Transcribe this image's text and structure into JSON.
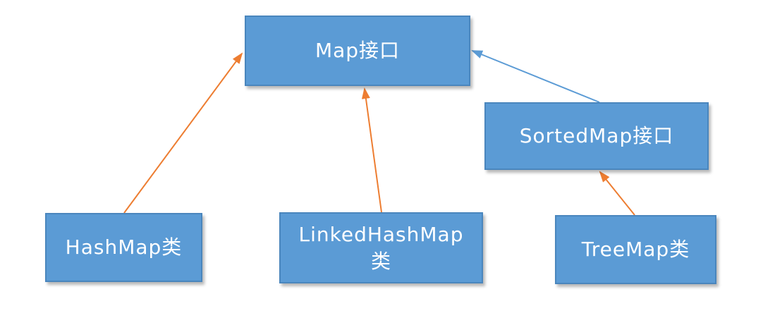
{
  "nodes": {
    "map_interface": "Map接口",
    "sortedmap_interface": "SortedMap接口",
    "hashmap_class": "HashMap类",
    "linkedhashmap_class_line1": "LinkedHashMap",
    "linkedhashmap_class_line2": "类",
    "treemap_class": "TreeMap类"
  },
  "colors": {
    "box_fill": "#5b9bd5",
    "box_border": "#4a86bd",
    "text": "#ffffff",
    "implementation_arrow": "#ed7d31",
    "interface_arrow": "#5b9bd5"
  },
  "edges": [
    {
      "from": "HashMap类",
      "to": "Map接口",
      "style": "orange"
    },
    {
      "from": "LinkedHashMap类",
      "to": "Map接口",
      "style": "orange"
    },
    {
      "from": "SortedMap接口",
      "to": "Map接口",
      "style": "blue"
    },
    {
      "from": "TreeMap类",
      "to": "SortedMap接口",
      "style": "orange"
    }
  ]
}
